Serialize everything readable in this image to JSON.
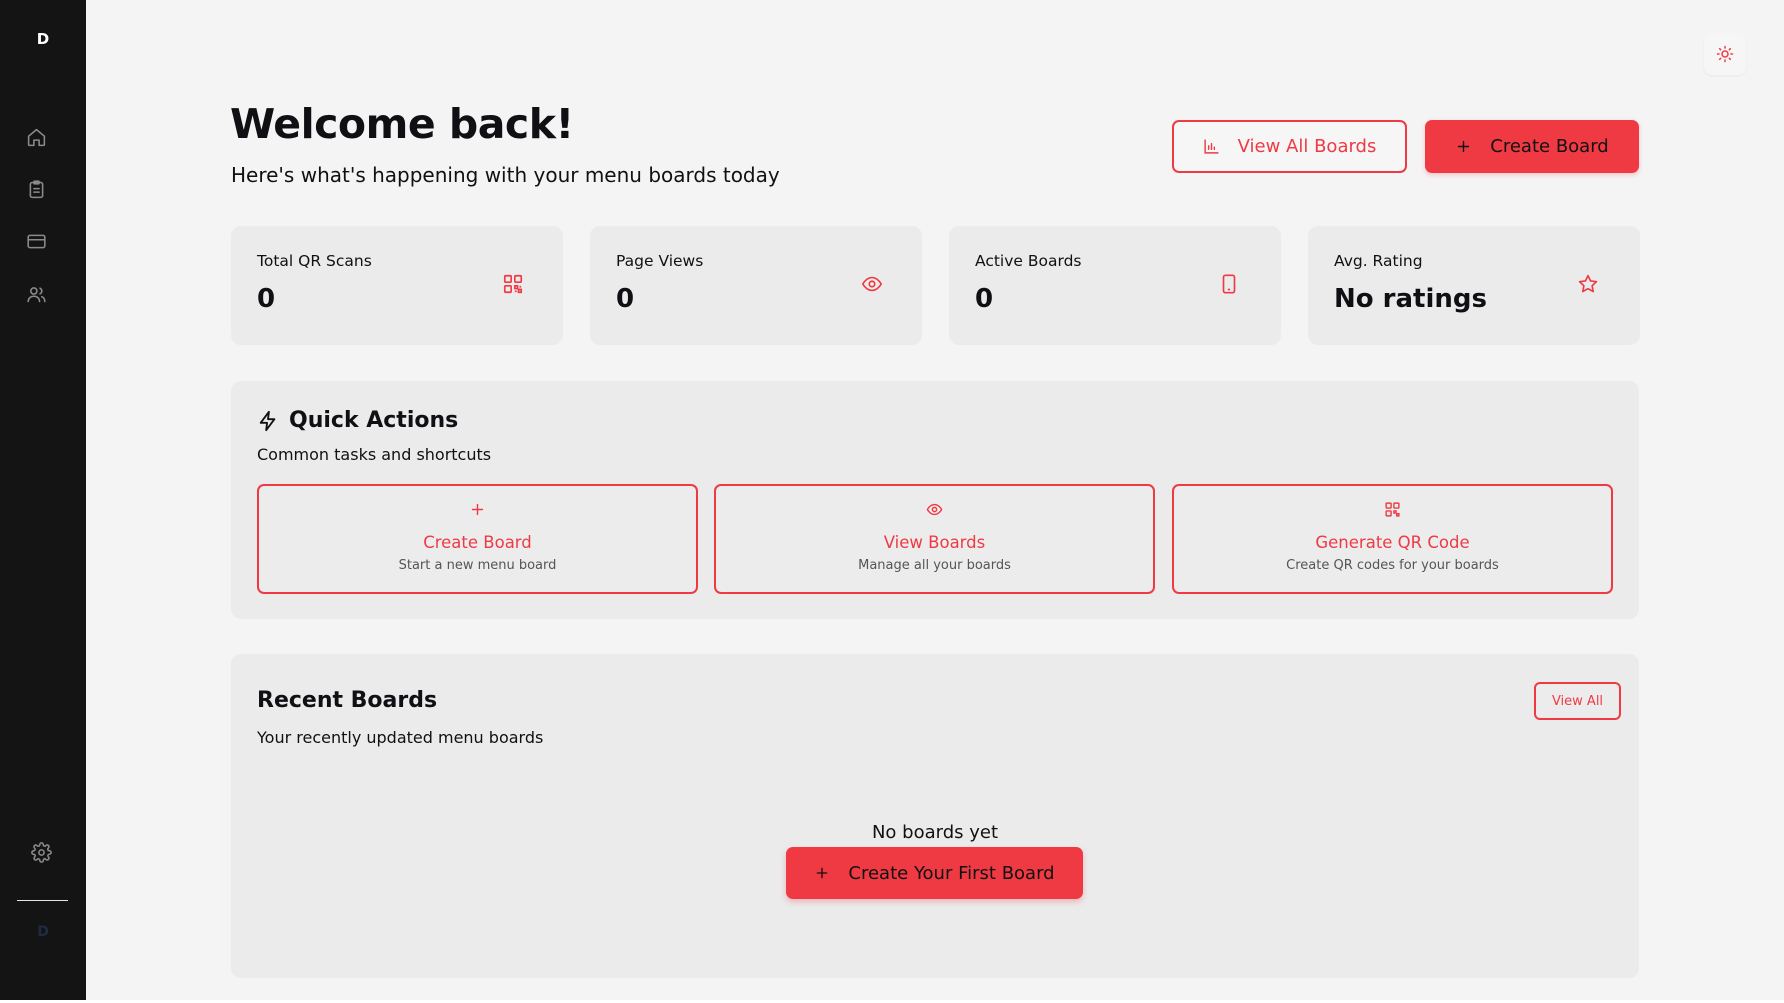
{
  "sidebar": {
    "logo": "D",
    "nav_icons": [
      "home-icon",
      "clipboard-icon",
      "credit-card-icon",
      "users-icon"
    ],
    "settings_icon": "gear-icon",
    "avatar_initial": "D"
  },
  "header": {
    "title": "Welcome back!",
    "subtitle": "Here's what's happening with your menu boards today",
    "view_all_boards_label": "View All Boards",
    "create_board_label": "Create Board",
    "theme_icon": "sun-icon"
  },
  "stats": [
    {
      "label": "Total QR Scans",
      "value": "0",
      "icon": "qr-code-icon"
    },
    {
      "label": "Page Views",
      "value": "0",
      "icon": "eye-icon"
    },
    {
      "label": "Active Boards",
      "value": "0",
      "icon": "tablet-icon"
    },
    {
      "label": "Avg. Rating",
      "value": "No ratings",
      "icon": "star-icon"
    }
  ],
  "quick_actions": {
    "title": "Quick Actions",
    "description": "Common tasks and shortcuts",
    "items": [
      {
        "title": "Create Board",
        "description": "Start a new menu board",
        "icon": "plus-icon"
      },
      {
        "title": "View Boards",
        "description": "Manage all your boards",
        "icon": "eye-icon"
      },
      {
        "title": "Generate QR Code",
        "description": "Create QR codes for your boards",
        "icon": "qr-code-icon"
      }
    ]
  },
  "recent_boards": {
    "title": "Recent Boards",
    "description": "Your recently updated menu boards",
    "view_all_label": "View All",
    "empty_text": "No boards yet",
    "create_first_label": "Create Your First Board"
  },
  "colors": {
    "accent": "#ef3a44",
    "sidebar_bg": "#141414",
    "page_bg": "#f4f4f4",
    "card_bg": "#ebebeb"
  }
}
